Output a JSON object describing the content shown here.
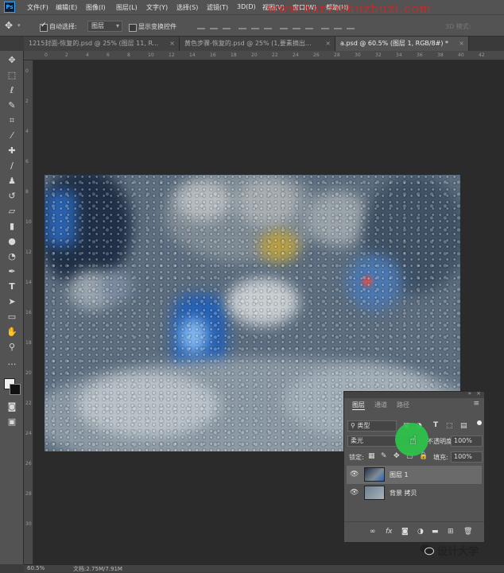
{
  "app": {
    "logo": "Ps"
  },
  "watermark": "www.hanzishuzhuzi.com",
  "menu": [
    "文件(F)",
    "编辑(E)",
    "图像(I)",
    "图层(L)",
    "文字(Y)",
    "选择(S)",
    "滤镜(T)",
    "3D(D)",
    "视图(V)",
    "窗口(W)",
    "帮助(H)"
  ],
  "options": {
    "auto_select_label": "自动选择:",
    "auto_select_value": "图层",
    "show_transform_label": "显示变换控件",
    "mode_3d_label": "3D 模式:"
  },
  "tabs": [
    {
      "label": "1215封面-恢复的.psd @ 25% (图层 11, R..."
    },
    {
      "label": "黄色步骤-恢复的.psd @ 25% (1,要素摘出..."
    },
    {
      "label": "a.psd @ 60.5% (图层 1, RGB/8#) *"
    }
  ],
  "ruler": {
    "top": [
      "0",
      "2",
      "4",
      "6",
      "8",
      "10",
      "12",
      "14",
      "16",
      "18",
      "20",
      "22",
      "24",
      "26",
      "28",
      "30",
      "32",
      "34",
      "36",
      "38",
      "40",
      "42"
    ],
    "left": [
      "0",
      "2",
      "4",
      "6",
      "8",
      "10",
      "12",
      "14",
      "16",
      "18",
      "20",
      "22",
      "24",
      "26",
      "28",
      "30"
    ]
  },
  "status": {
    "zoom": "60.5%",
    "doc_info": "文档:2.75M/7.91M"
  },
  "layers_panel": {
    "tabs": [
      "图层",
      "通道",
      "路径"
    ],
    "filter_kind": "类型",
    "blend_mode": "柔光",
    "opacity_label": "不透明度:",
    "opacity_value": "100%",
    "lock_label": "锁定:",
    "fill_label": "填充:",
    "fill_value": "100%",
    "layers": [
      {
        "name": "图层 1",
        "selected": true
      },
      {
        "name": "背景 拷贝",
        "selected": false
      }
    ]
  },
  "brand": "设计大学",
  "colors": {
    "accent": "#31a8ff",
    "highlight": "#2ec24a",
    "watermark": "#dd2222"
  }
}
